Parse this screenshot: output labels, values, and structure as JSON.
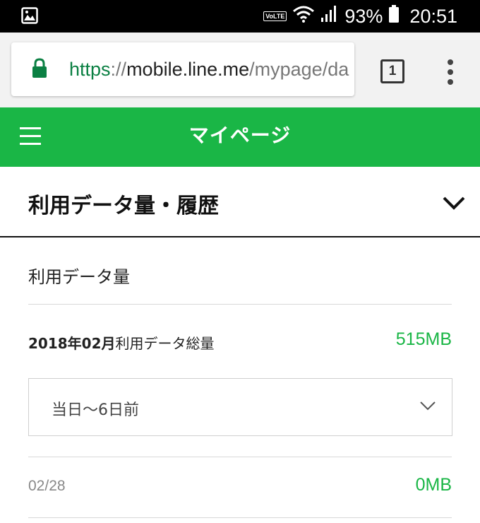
{
  "status_bar": {
    "volte_label": "VoLTE",
    "battery": "93%",
    "time": "20:51"
  },
  "browser": {
    "url_scheme": "https",
    "url_separator": "://",
    "url_host": "mobile.line.me",
    "url_path": "/mypage/da",
    "tab_count": "1"
  },
  "header": {
    "title": "マイページ"
  },
  "section": {
    "title": "利用データ量・履歴"
  },
  "usage": {
    "subheading": "利用データ量",
    "total_period": "2018年02月",
    "total_label": "利用データ総量",
    "total_value": "515MB",
    "range_selected": "当日〜6日前",
    "days": [
      {
        "date": "02/28",
        "value": "0MB"
      }
    ]
  },
  "colors": {
    "brand_green": "#1ab646",
    "url_scheme_green": "#0b8043"
  },
  "icons": {
    "gallery": "image-icon",
    "wifi": "wifi-icon",
    "signal": "signal-icon",
    "battery": "battery-icon",
    "lock": "lock-icon",
    "menu": "more-vert-icon",
    "hamburger": "hamburger-icon",
    "chevron": "chevron-down-icon"
  }
}
